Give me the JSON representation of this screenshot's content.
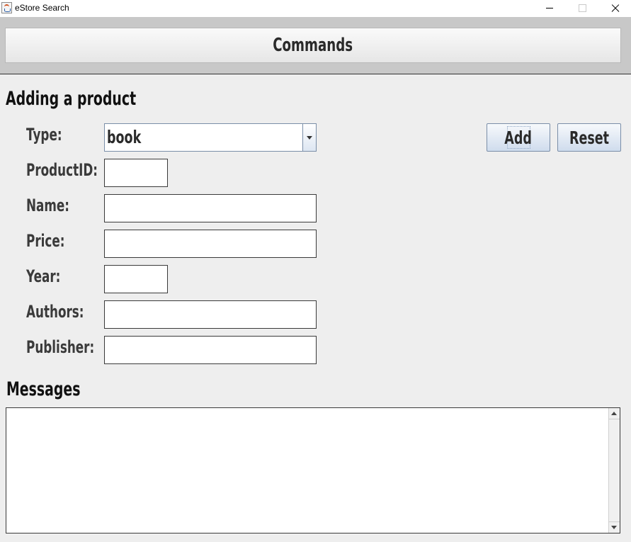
{
  "window": {
    "title": "eStore Search",
    "icon": "java-cup-icon"
  },
  "commands": {
    "title": "Commands"
  },
  "add_product": {
    "heading": "Adding a product",
    "type_label": "Type:",
    "type_value": "book",
    "product_id_label": "ProductID:",
    "product_id_value": "",
    "name_label": "Name:",
    "name_value": "",
    "price_label": "Price:",
    "price_value": "",
    "year_label": "Year:",
    "year_value": "",
    "authors_label": "Authors:",
    "authors_value": "",
    "publisher_label": "Publisher:",
    "publisher_value": "",
    "add_button": "Add",
    "reset_button": "Reset"
  },
  "messages": {
    "heading": "Messages",
    "content": ""
  }
}
